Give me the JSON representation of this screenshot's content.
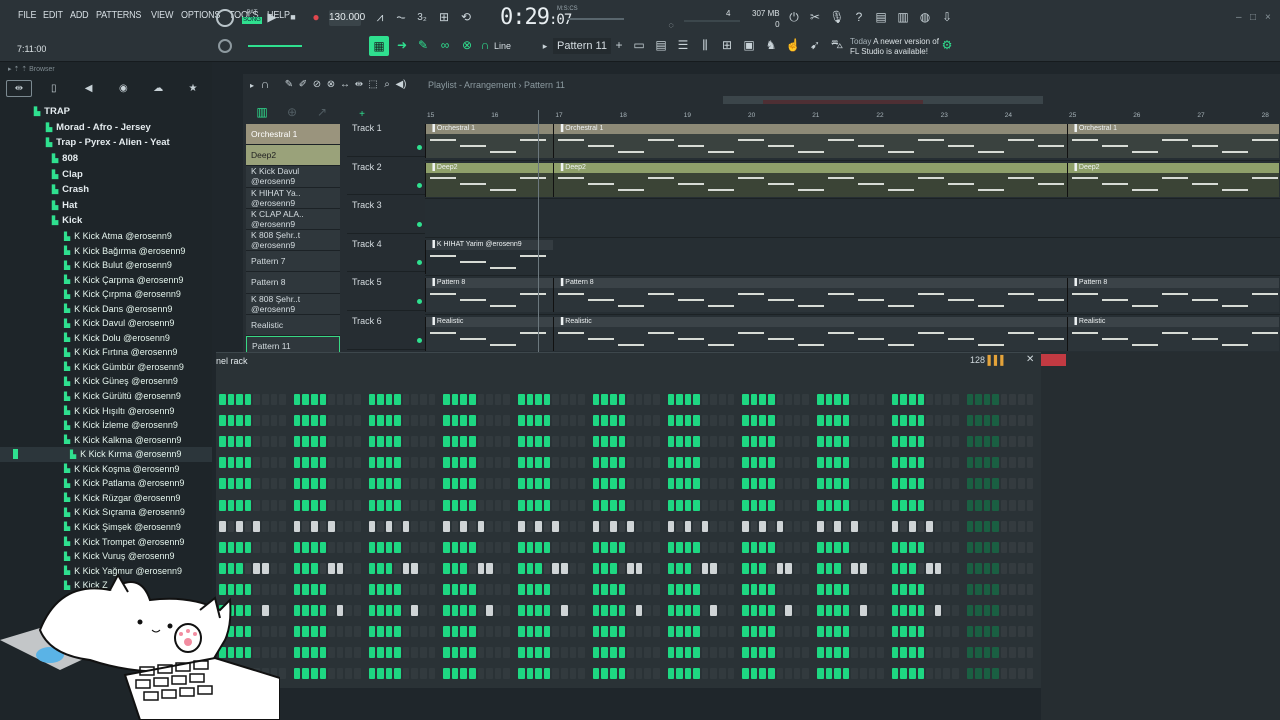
{
  "menu": [
    "FILE",
    "EDIT",
    "ADD",
    "PATTERNS",
    "VIEW",
    "OPTIONS",
    "TOOLS",
    "HELP"
  ],
  "transport": {
    "mode_label": "SONG",
    "pat_label": "PAT",
    "tempo": "130.000",
    "time_main": "0:29",
    "time_sub": "07",
    "time_unit": "M:S:CS",
    "cpu": "4",
    "cpu_sub": "",
    "mem": "307 MB",
    "mem_sub": "0",
    "clock": "7:11:00"
  },
  "toolbar2": {
    "snap_mode": "Line",
    "pattern_selector": "Pattern 11",
    "news_date": "Today",
    "news_text_1": "A newer version of",
    "news_text_2": "FL Studio is available!"
  },
  "browser": {
    "title": "Browser",
    "tree": [
      {
        "label": "TRAP",
        "type": "folder",
        "indent": 1
      },
      {
        "label": "Morad - Afro - Jersey",
        "type": "folder",
        "indent": 2
      },
      {
        "label": "Trap - Pyrex - Alien - Yeat",
        "type": "folder",
        "indent": 2
      },
      {
        "label": "808",
        "type": "folder",
        "indent": 3
      },
      {
        "label": "Clap",
        "type": "folder",
        "indent": 3
      },
      {
        "label": "Crash",
        "type": "folder",
        "indent": 3
      },
      {
        "label": "Hat",
        "type": "folder",
        "indent": 3
      },
      {
        "label": "Kick",
        "type": "folder",
        "indent": 3
      },
      {
        "label": "K Kick Atma @erosenn9",
        "type": "file"
      },
      {
        "label": "K Kick Bağırma @erosenn9",
        "type": "file"
      },
      {
        "label": "K Kick Bulut @erosenn9",
        "type": "file"
      },
      {
        "label": "K Kick Çarpma @erosenn9",
        "type": "file"
      },
      {
        "label": "K Kick Çırpma @erosenn9",
        "type": "file"
      },
      {
        "label": "K Kick Dans @erosenn9",
        "type": "file"
      },
      {
        "label": "K Kick Davul @erosenn9",
        "type": "file"
      },
      {
        "label": "K Kick Dolu @erosenn9",
        "type": "file"
      },
      {
        "label": "K Kick Fırtına @erosenn9",
        "type": "file"
      },
      {
        "label": "K Kick Gümbür @erosenn9",
        "type": "file"
      },
      {
        "label": "K Kick Güneş @erosenn9",
        "type": "file"
      },
      {
        "label": "K Kick Gürültü @erosenn9",
        "type": "file"
      },
      {
        "label": "K Kick Hışıltı @erosenn9",
        "type": "file"
      },
      {
        "label": "K Kick İzleme @erosenn9",
        "type": "file"
      },
      {
        "label": "K Kick Kalkma @erosenn9",
        "type": "file"
      },
      {
        "label": "K Kick Kırma @erosenn9",
        "type": "file",
        "selected": true
      },
      {
        "label": "K Kick Koşma @erosenn9",
        "type": "file"
      },
      {
        "label": "K Kick Patlama @erosenn9",
        "type": "file"
      },
      {
        "label": "K Kick Rüzgar @erosenn9",
        "type": "file"
      },
      {
        "label": "K Kick Sıçrama @erosenn9",
        "type": "file"
      },
      {
        "label": "K Kick Şimşek @erosenn9",
        "type": "file"
      },
      {
        "label": "K Kick Trompet @erosenn9",
        "type": "file"
      },
      {
        "label": "K Kick Vuruş @erosenn9",
        "type": "file"
      },
      {
        "label": "K Kick Yağmur @erosenn9",
        "type": "file"
      },
      {
        "label": "K Kick Z",
        "type": "file"
      }
    ]
  },
  "playlist": {
    "title": "Playlist - Arrangement",
    "pattern_name": "Pattern 11",
    "patterns": [
      {
        "label": "Orchestral 1",
        "style": "tan"
      },
      {
        "label": "Deep2",
        "style": "green"
      },
      {
        "label": "K Kick Davul @erosenn9",
        "style": "dark"
      },
      {
        "label": "K HIHAT Ya.. @erosenn9",
        "style": "dark"
      },
      {
        "label": "K CLAP ALA.. @erosenn9",
        "style": "dark"
      },
      {
        "label": "K 808 Şehr..t @erosenn9",
        "style": "dark"
      },
      {
        "label": "Pattern 7",
        "style": "dark"
      },
      {
        "label": "Pattern 8",
        "style": "dark"
      },
      {
        "label": "K 808 Şehr..t @erosenn9",
        "style": "dark"
      },
      {
        "label": "Realistic",
        "style": "dark"
      },
      {
        "label": "Pattern 11",
        "style": "current"
      }
    ],
    "tracks": [
      "Track 1",
      "Track 2",
      "Track 3",
      "Track 4",
      "Track 5",
      "Track 6"
    ],
    "ruler": [
      "15",
      "16",
      "17",
      "18",
      "19",
      "20",
      "21",
      "22",
      "23",
      "24",
      "25",
      "26",
      "27",
      "28"
    ],
    "clips": [
      {
        "track": 0,
        "label": "Orchestral 1",
        "kind": "orch",
        "bars": [
          [
            15,
            17
          ],
          [
            17,
            25
          ],
          [
            25,
            28.3
          ]
        ]
      },
      {
        "track": 1,
        "label": "Deep2",
        "kind": "deep",
        "bars": [
          [
            15,
            17
          ],
          [
            17,
            25
          ],
          [
            25,
            28.3
          ]
        ]
      },
      {
        "track": 3,
        "label": "K HIHAT Yarim @erosenn9",
        "kind": "hihat",
        "bars": [
          [
            15,
            17
          ]
        ]
      },
      {
        "track": 4,
        "label": "Pattern 8",
        "kind": "pat8",
        "bars": [
          [
            15,
            17
          ],
          [
            17,
            25
          ],
          [
            25,
            28.3
          ]
        ]
      },
      {
        "track": 5,
        "label": "Realistic",
        "kind": "real",
        "bars": [
          [
            15,
            17
          ],
          [
            17,
            25
          ],
          [
            25,
            28.3
          ]
        ]
      }
    ]
  },
  "rack": {
    "title": "nel rack",
    "swing": "128",
    "rows": [
      "g",
      "g",
      "g",
      "g",
      "g",
      "g",
      "w",
      "g",
      "mix",
      "g",
      "w2",
      "g",
      "g",
      "g"
    ]
  }
}
